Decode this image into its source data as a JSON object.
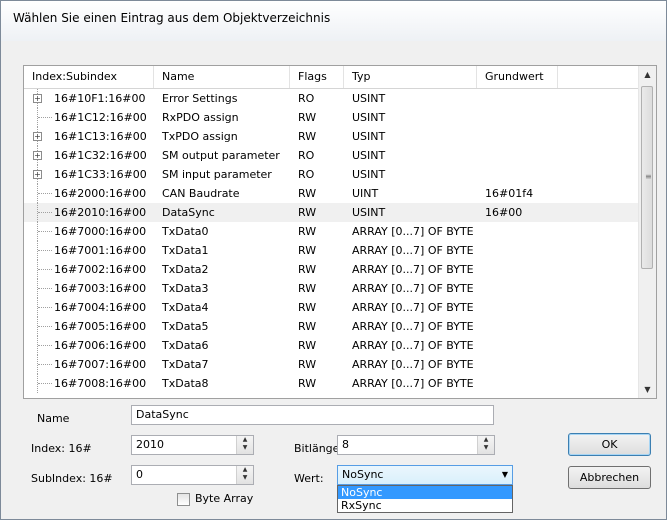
{
  "dialog": {
    "title": "Wählen Sie einen Eintrag aus dem Objektverzeichnis"
  },
  "table": {
    "columns": [
      "Index:Subindex",
      "Name",
      "Flags",
      "Typ",
      "Grundwert"
    ],
    "rows": [
      {
        "index": "16#10F1:16#00",
        "name": "Error Settings",
        "flags": "RO",
        "type": "USINT",
        "default": "",
        "expandable": true
      },
      {
        "index": "16#1C12:16#00",
        "name": "RxPDO assign",
        "flags": "RW",
        "type": "USINT",
        "default": "",
        "expandable": false
      },
      {
        "index": "16#1C13:16#00",
        "name": "TxPDO assign",
        "flags": "RW",
        "type": "USINT",
        "default": "",
        "expandable": true
      },
      {
        "index": "16#1C32:16#00",
        "name": "SM output parameter",
        "flags": "RO",
        "type": "USINT",
        "default": "",
        "expandable": true
      },
      {
        "index": "16#1C33:16#00",
        "name": "SM input parameter",
        "flags": "RO",
        "type": "USINT",
        "default": "",
        "expandable": true
      },
      {
        "index": "16#2000:16#00",
        "name": "CAN Baudrate",
        "flags": "RW",
        "type": "UINT",
        "default": "16#01f4",
        "expandable": false
      },
      {
        "index": "16#2010:16#00",
        "name": "DataSync",
        "flags": "RW",
        "type": "USINT",
        "default": "16#00",
        "expandable": false,
        "selected": true
      },
      {
        "index": "16#7000:16#00",
        "name": "TxData0",
        "flags": "RW",
        "type": "ARRAY [0...7] OF BYTE",
        "default": "",
        "expandable": false
      },
      {
        "index": "16#7001:16#00",
        "name": "TxData1",
        "flags": "RW",
        "type": "ARRAY [0...7] OF BYTE",
        "default": "",
        "expandable": false
      },
      {
        "index": "16#7002:16#00",
        "name": "TxData2",
        "flags": "RW",
        "type": "ARRAY [0...7] OF BYTE",
        "default": "",
        "expandable": false
      },
      {
        "index": "16#7003:16#00",
        "name": "TxData3",
        "flags": "RW",
        "type": "ARRAY [0...7] OF BYTE",
        "default": "",
        "expandable": false
      },
      {
        "index": "16#7004:16#00",
        "name": "TxData4",
        "flags": "RW",
        "type": "ARRAY [0...7] OF BYTE",
        "default": "",
        "expandable": false
      },
      {
        "index": "16#7005:16#00",
        "name": "TxData5",
        "flags": "RW",
        "type": "ARRAY [0...7] OF BYTE",
        "default": "",
        "expandable": false
      },
      {
        "index": "16#7006:16#00",
        "name": "TxData6",
        "flags": "RW",
        "type": "ARRAY [0...7] OF BYTE",
        "default": "",
        "expandable": false
      },
      {
        "index": "16#7007:16#00",
        "name": "TxData7",
        "flags": "RW",
        "type": "ARRAY [0...7] OF BYTE",
        "default": "",
        "expandable": false
      },
      {
        "index": "16#7008:16#00",
        "name": "TxData8",
        "flags": "RW",
        "type": "ARRAY [0...7] OF BYTE",
        "default": "",
        "expandable": false
      }
    ]
  },
  "form": {
    "name_label": "Name",
    "name_value": "DataSync",
    "index_label": "Index: 16#",
    "index_value": "2010",
    "subindex_label": "SubIndex: 16#",
    "subindex_value": "0",
    "bytearray_label": "Byte Array",
    "bitlength_label": "Bitlänge:",
    "bitlength_value": "8",
    "value_label": "Wert:",
    "value_selected": "NoSync",
    "value_options": [
      "NoSync",
      "RxSync"
    ]
  },
  "buttons": {
    "ok": "OK",
    "cancel": "Abbrechen"
  },
  "icons": {
    "expand": "plus-expander-icon",
    "scroll_up": "scroll-up-arrow-icon",
    "scroll_down": "scroll-down-arrow-icon",
    "dropdown": "dropdown-arrow-icon",
    "spin": "spin-up-down-icon"
  }
}
